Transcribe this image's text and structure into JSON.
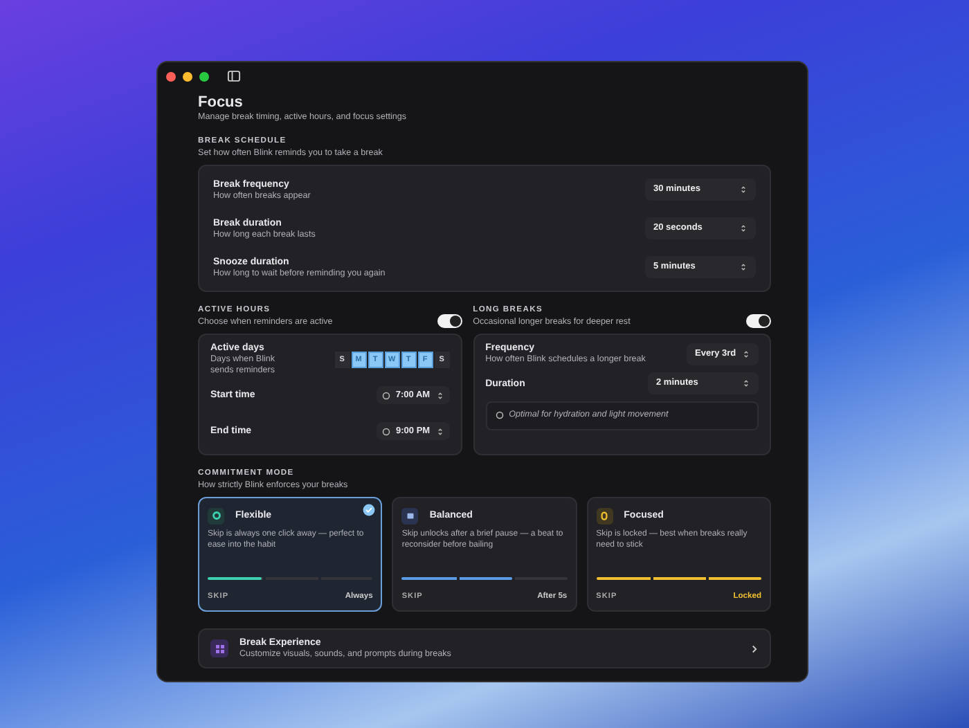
{
  "page": {
    "title": "Focus",
    "subtitle": "Manage break timing, active hours, and focus settings"
  },
  "break_schedule": {
    "label": "BREAK SCHEDULE",
    "description": "Set how often Blink reminds you to take a break",
    "rows": [
      {
        "title": "Break frequency",
        "description": "How often breaks appear",
        "value": "30 minutes"
      },
      {
        "title": "Break duration",
        "description": "How long each break lasts",
        "value": "20 seconds"
      },
      {
        "title": "Snooze duration",
        "description": "How long to wait before reminding you again",
        "value": "5 minutes"
      }
    ]
  },
  "active_hours": {
    "label": "ACTIVE HOURS",
    "description": "Choose when reminders are active",
    "on": true,
    "days_title": "Active days",
    "days_description": "Days when Blink sends reminders",
    "days": [
      {
        "label": "S",
        "selected": false
      },
      {
        "label": "M",
        "selected": true
      },
      {
        "label": "T",
        "selected": true
      },
      {
        "label": "W",
        "selected": true
      },
      {
        "label": "T",
        "selected": true
      },
      {
        "label": "F",
        "selected": true
      },
      {
        "label": "S",
        "selected": false
      }
    ],
    "times": [
      {
        "title": "Start time",
        "value": "7:00 AM"
      },
      {
        "title": "End time",
        "value": "9:00 PM"
      }
    ]
  },
  "long_breaks": {
    "label": "LONG BREAKS",
    "description": "Occasional longer breaks for deeper rest",
    "on": true,
    "frequency_title": "Frequency",
    "frequency_description": "How often Blink schedules a longer break",
    "frequency_value": "Every 3rd",
    "duration_title": "Duration",
    "duration_value": "2 minutes",
    "note": "Optimal for hydration and light movement"
  },
  "commitment_mode": {
    "label": "COMMITMENT MODE",
    "description": "How strictly Blink enforces your breaks",
    "modes": [
      {
        "kind": "flexible",
        "name": "Flexible",
        "description": "Skip is always one click away — perfect to ease into the habit",
        "skip_label": "SKIP",
        "skip_value": "Always",
        "level": 0.33,
        "color": "#3ecfb0",
        "selected": true
      },
      {
        "kind": "balanced",
        "name": "Balanced",
        "description": "Skip unlocks after a brief pause — a beat to reconsider before bailing",
        "skip_label": "SKIP",
        "skip_value": "After 5s",
        "level": 0.67,
        "color": "#5b9be6",
        "selected": false
      },
      {
        "kind": "focused",
        "name": "Focused",
        "description": "Skip is locked — best when breaks really need to stick",
        "skip_label": "SKIP",
        "skip_value": "Locked",
        "level": 1,
        "color": "#f0c030",
        "selected": false
      }
    ]
  },
  "break_experience": {
    "title": "Break Experience",
    "description": "Customize visuals, sounds, and prompts during breaks"
  }
}
